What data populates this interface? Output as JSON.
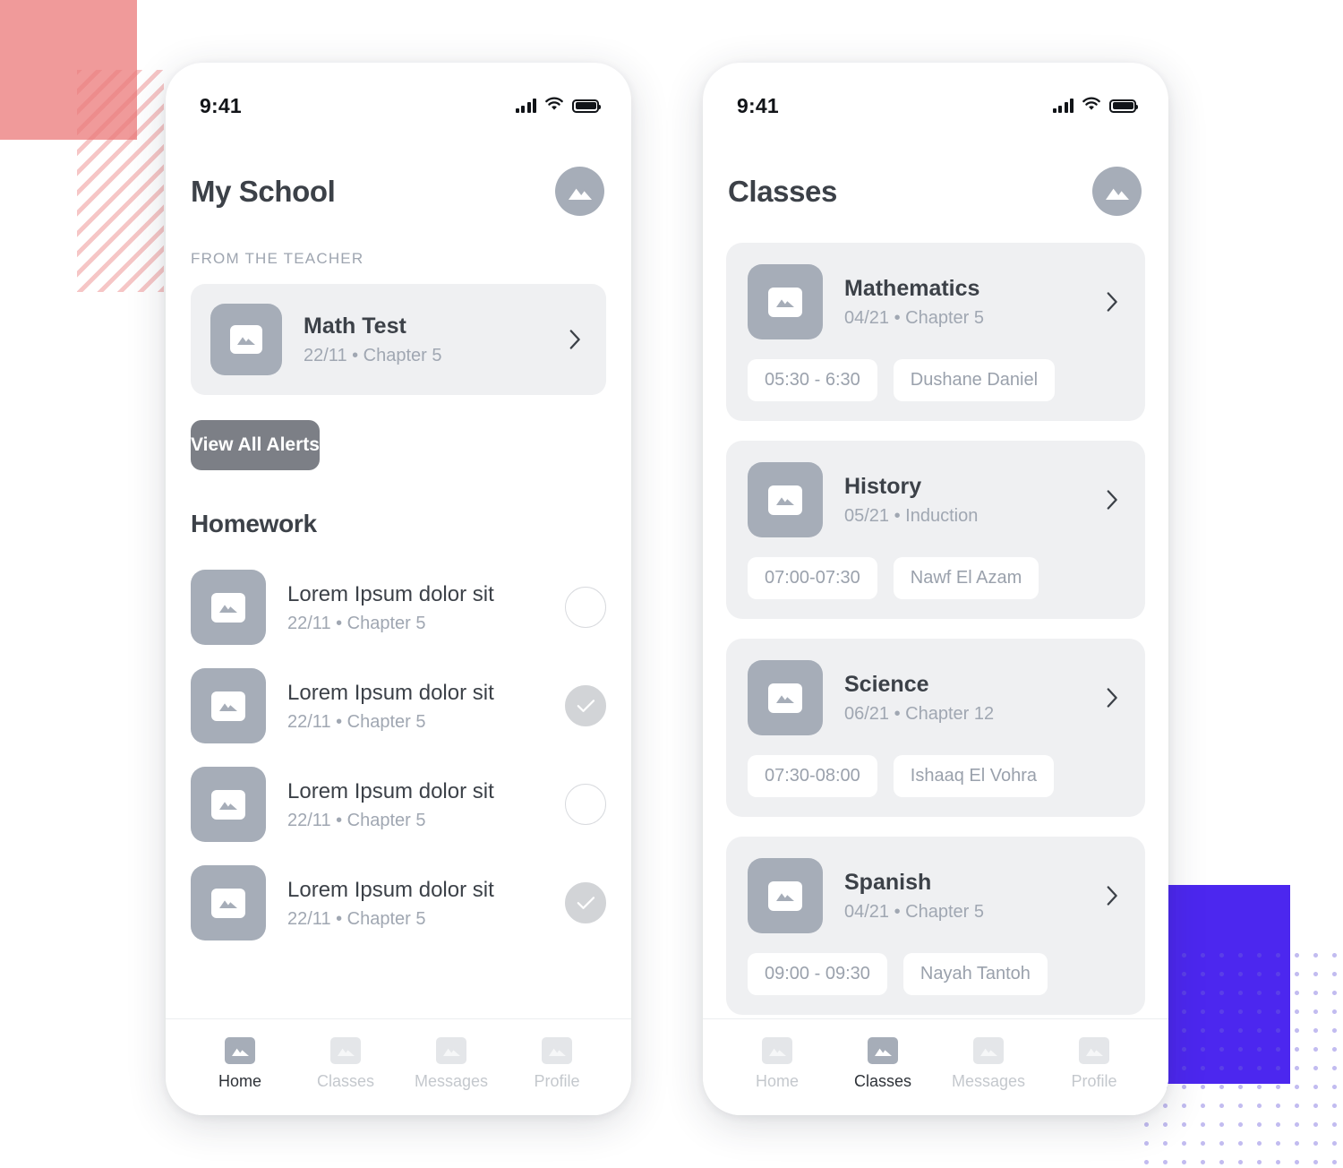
{
  "theme": {
    "accent_pink": "#f09a9a",
    "accent_blue": "#4c27ef",
    "card_bg": "#eff0f2",
    "thumb_gray": "#a6adb8",
    "button_gray": "#7c7f86",
    "text_dark": "#3c4148",
    "text_muted": "#a0a7b2"
  },
  "phone_home": {
    "status": {
      "time": "9:41",
      "signal_icon": "signal-bars-icon",
      "wifi_icon": "wifi-icon",
      "battery_icon": "battery-full-icon"
    },
    "header": {
      "title": "My School",
      "avatar_icon": "image-placeholder-icon"
    },
    "eyebrow": "FROM THE TEACHER",
    "alert_card": {
      "thumb_icon": "image-placeholder-icon",
      "title": "Math Test",
      "subtitle": "22/11  •  Chapter 5",
      "chevron_icon": "chevron-right-icon"
    },
    "primary_button": "View All Alerts",
    "homework_heading": "Homework",
    "homework": [
      {
        "thumb_icon": "image-placeholder-icon",
        "title": "Lorem Ipsum dolor sit",
        "subtitle": "22/11  •  Chapter 5",
        "checked": false
      },
      {
        "thumb_icon": "image-placeholder-icon",
        "title": "Lorem Ipsum dolor sit",
        "subtitle": "22/11  •  Chapter 5",
        "checked": true
      },
      {
        "thumb_icon": "image-placeholder-icon",
        "title": "Lorem Ipsum dolor sit",
        "subtitle": "22/11  •  Chapter 5",
        "checked": false
      },
      {
        "thumb_icon": "image-placeholder-icon",
        "title": "Lorem Ipsum dolor sit",
        "subtitle": "22/11  •  Chapter 5",
        "checked": true
      }
    ],
    "tabs": [
      {
        "label": "Home",
        "icon": "image-placeholder-icon",
        "active": true
      },
      {
        "label": "Classes",
        "icon": "image-placeholder-icon",
        "active": false
      },
      {
        "label": "Messages",
        "icon": "image-placeholder-icon",
        "active": false
      },
      {
        "label": "Profile",
        "icon": "image-placeholder-icon",
        "active": false
      }
    ]
  },
  "phone_classes": {
    "status": {
      "time": "9:41",
      "signal_icon": "signal-bars-icon",
      "wifi_icon": "wifi-icon",
      "battery_icon": "battery-full-icon"
    },
    "header": {
      "title": "Classes",
      "avatar_icon": "image-placeholder-icon"
    },
    "classes": [
      {
        "thumb_icon": "image-placeholder-icon",
        "title": "Mathematics",
        "subtitle": "04/21  •  Chapter 5",
        "time": "05:30 - 6:30",
        "teacher": "Dushane Daniel",
        "chevron_icon": "chevron-right-icon"
      },
      {
        "thumb_icon": "image-placeholder-icon",
        "title": "History",
        "subtitle": "05/21  •  Induction",
        "time": "07:00-07:30",
        "teacher": "Nawf El Azam",
        "chevron_icon": "chevron-right-icon"
      },
      {
        "thumb_icon": "image-placeholder-icon",
        "title": "Science",
        "subtitle": "06/21  •  Chapter 12",
        "time": "07:30-08:00",
        "teacher": "Ishaaq El Vohra",
        "chevron_icon": "chevron-right-icon"
      },
      {
        "thumb_icon": "image-placeholder-icon",
        "title": "Spanish",
        "subtitle": "04/21  •  Chapter 5",
        "time": "09:00 - 09:30",
        "teacher": "Nayah Tantoh",
        "chevron_icon": "chevron-right-icon"
      }
    ],
    "tabs": [
      {
        "label": "Home",
        "icon": "image-placeholder-icon",
        "active": false
      },
      {
        "label": "Classes",
        "icon": "image-placeholder-icon",
        "active": true
      },
      {
        "label": "Messages",
        "icon": "image-placeholder-icon",
        "active": false
      },
      {
        "label": "Profile",
        "icon": "image-placeholder-icon",
        "active": false
      }
    ]
  }
}
